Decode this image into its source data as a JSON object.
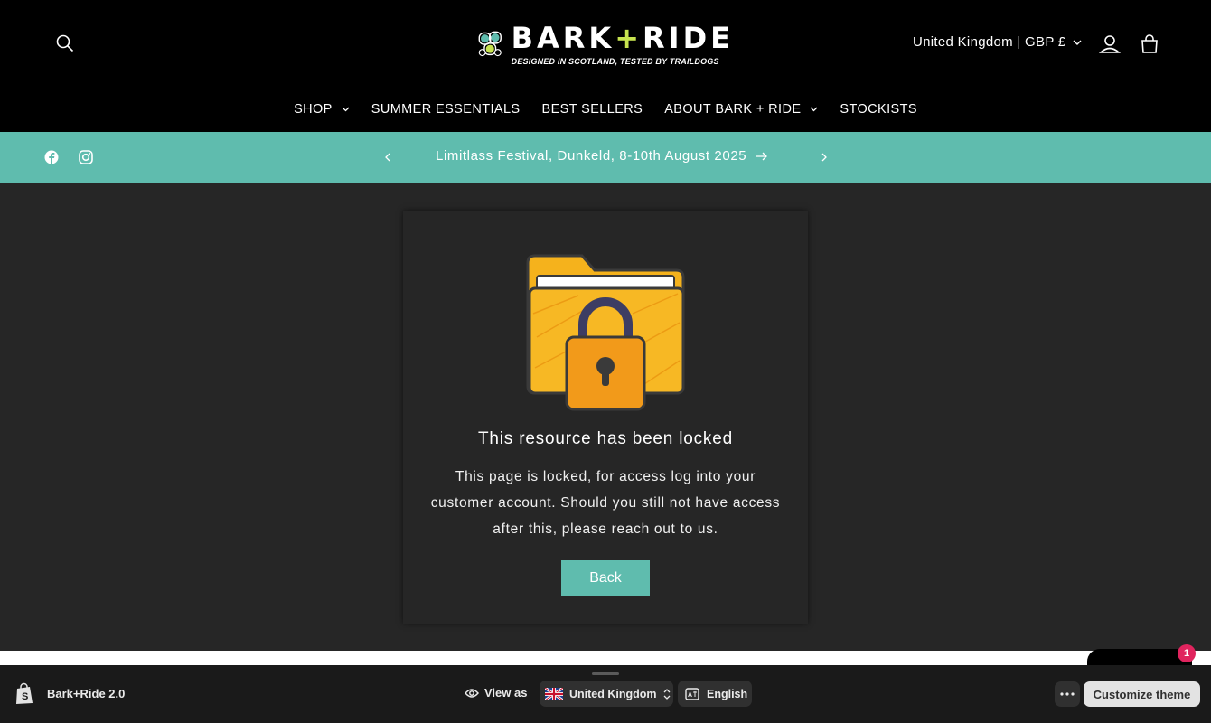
{
  "header": {
    "logo": {
      "title_left": "BARK",
      "title_plus": "+",
      "title_right": "RIDE",
      "tagline": "DESIGNED IN SCOTLAND, TESTED BY TRAILDOGS"
    },
    "country_selector": "United Kingdom | GBP £",
    "icons": {
      "search": "search-icon",
      "account": "account-icon",
      "cart": "cart-icon"
    }
  },
  "nav": {
    "items": [
      {
        "label": "SHOP",
        "has_dropdown": true
      },
      {
        "label": "SUMMER ESSENTIALS",
        "has_dropdown": false
      },
      {
        "label": "BEST SELLERS",
        "has_dropdown": false
      },
      {
        "label": "ABOUT BARK + RIDE",
        "has_dropdown": true
      },
      {
        "label": "STOCKISTS",
        "has_dropdown": false
      }
    ]
  },
  "announcement": {
    "text": "Limitlass Festival, Dunkeld, 8-10th August 2025",
    "social": [
      "facebook-icon",
      "instagram-icon"
    ]
  },
  "locked": {
    "title": "This resource has been locked",
    "body": "This page is locked, for access log into your customer account. Should you still not have access after this, please reach out to us.",
    "back_label": "Back"
  },
  "chat": {
    "badge": "1"
  },
  "admin_bar": {
    "theme_name": "Bark+Ride 2.0",
    "view_as": "View as",
    "country": "United Kingdom",
    "language": "English",
    "customize": "Customize theme"
  },
  "colors": {
    "accent": "#5fbcae",
    "header_bg": "#000000",
    "page_bg": "#262626",
    "logo_plus": "#c7e34f",
    "lock_yellow": "#f5b21c"
  }
}
